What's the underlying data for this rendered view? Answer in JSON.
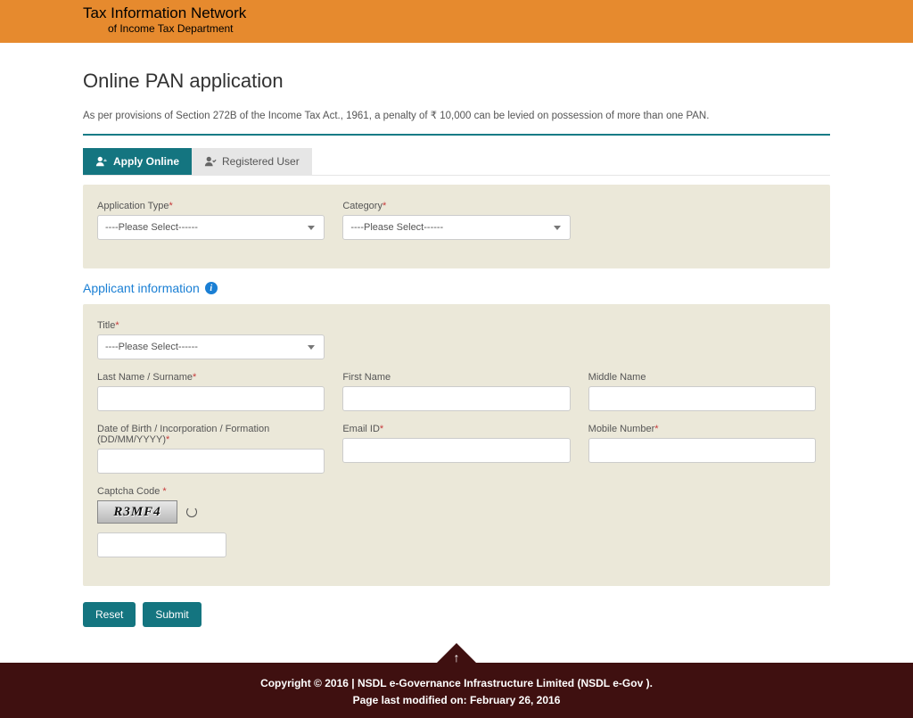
{
  "header": {
    "title": "Tax Information Network",
    "subtitle": "of Income Tax Department"
  },
  "page": {
    "title": "Online PAN application",
    "notice": "As per provisions of Section 272B of the Income Tax Act., 1961, a penalty of ₹ 10,000 can be levied on possession of more than one PAN."
  },
  "tabs": {
    "apply": "Apply Online",
    "registered": "Registered User"
  },
  "form": {
    "app_type_label": "Application Type",
    "category_label": "Category",
    "please_select": "----Please Select------",
    "section_heading": "Applicant information",
    "title_label": "Title",
    "last_name_label": "Last Name / Surname",
    "first_name_label": "First Name",
    "middle_name_label": "Middle Name",
    "dob_label": "Date of Birth / Incorporation / Formation (DD/MM/YYYY)",
    "email_label": "Email ID",
    "mobile_label": "Mobile Number",
    "captcha_label": "Captcha Code ",
    "captcha_value": "R3MF4"
  },
  "buttons": {
    "reset": "Reset",
    "submit": "Submit"
  },
  "footer": {
    "copyright": "Copyright © 2016 | NSDL e-Governance Infrastructure Limited (NSDL e-Gov ).",
    "modified": "Page last modified on: February 26, 2016"
  }
}
